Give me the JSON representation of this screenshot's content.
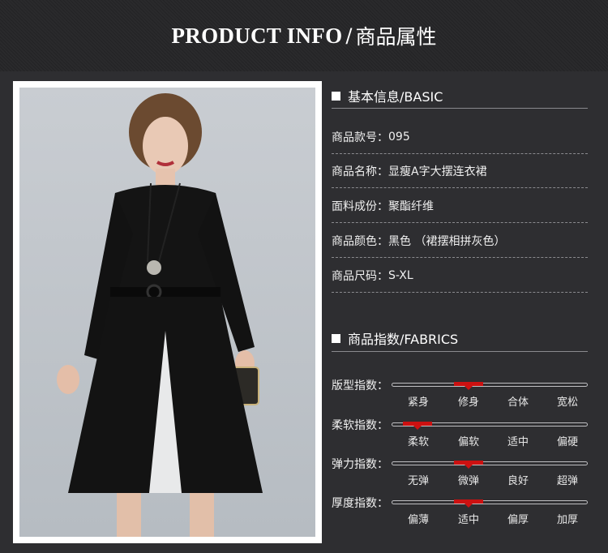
{
  "header": {
    "title_en": "PRODUCT INFO",
    "separator": "/",
    "title_cn": "商品属性"
  },
  "basic": {
    "title": "基本信息/BASIC",
    "rows": [
      {
        "label": "商品款号：",
        "value": "095"
      },
      {
        "label": "商品名称：",
        "value": "显瘦A字大摆连衣裙"
      },
      {
        "label": "面料成份：",
        "value": "聚酯纤维"
      },
      {
        "label": "商品颜色：",
        "value": "黑色 （裙摆相拼灰色）"
      },
      {
        "label": "商品尺码：",
        "value": "S-XL"
      }
    ]
  },
  "fabrics": {
    "title": "商品指数/FABRICS",
    "rows": [
      {
        "label": "版型指数：",
        "options": [
          "紧身",
          "修身",
          "合体",
          "宽松"
        ],
        "selected": "修身"
      },
      {
        "label": "柔软指数：",
        "options": [
          "柔软",
          "偏软",
          "适中",
          "偏硬"
        ],
        "selected": "柔软"
      },
      {
        "label": "弹力指数：",
        "options": [
          "无弹",
          "微弹",
          "良好",
          "超弹"
        ],
        "selected": "微弹"
      },
      {
        "label": "厚度指数：",
        "options": [
          "偏薄",
          "适中",
          "偏厚",
          "加厚"
        ],
        "selected": "适中"
      }
    ]
  },
  "colors": {
    "marker": "#cc1111",
    "background": "#2e2e31"
  },
  "image": {
    "description_icon": "model-photo"
  }
}
